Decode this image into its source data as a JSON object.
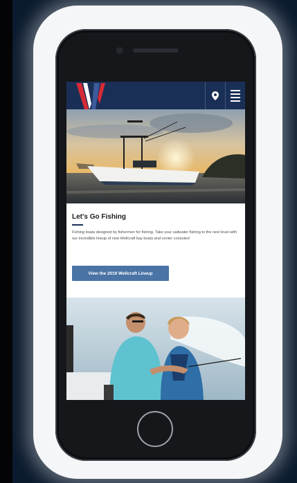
{
  "page": {
    "title": "Let's Go Fishing",
    "body": "Fishing boats designed by fishermen for fishing. Take your saltwater fishing to the next level with our incredible lineup of new Wellcraft bay boats and center consoles!",
    "cta_label": "View the 2019 Wellcraft Lineup"
  },
  "header": {
    "logo": "wellcraft-logo",
    "location_icon": "location-pin-icon",
    "menu_icon": "hamburger-menu-icon"
  },
  "colors": {
    "header": "#1a2f55",
    "cta": "#4a73a6",
    "logo_red": "#d62a37",
    "logo_blue": "#3c5a9c"
  }
}
